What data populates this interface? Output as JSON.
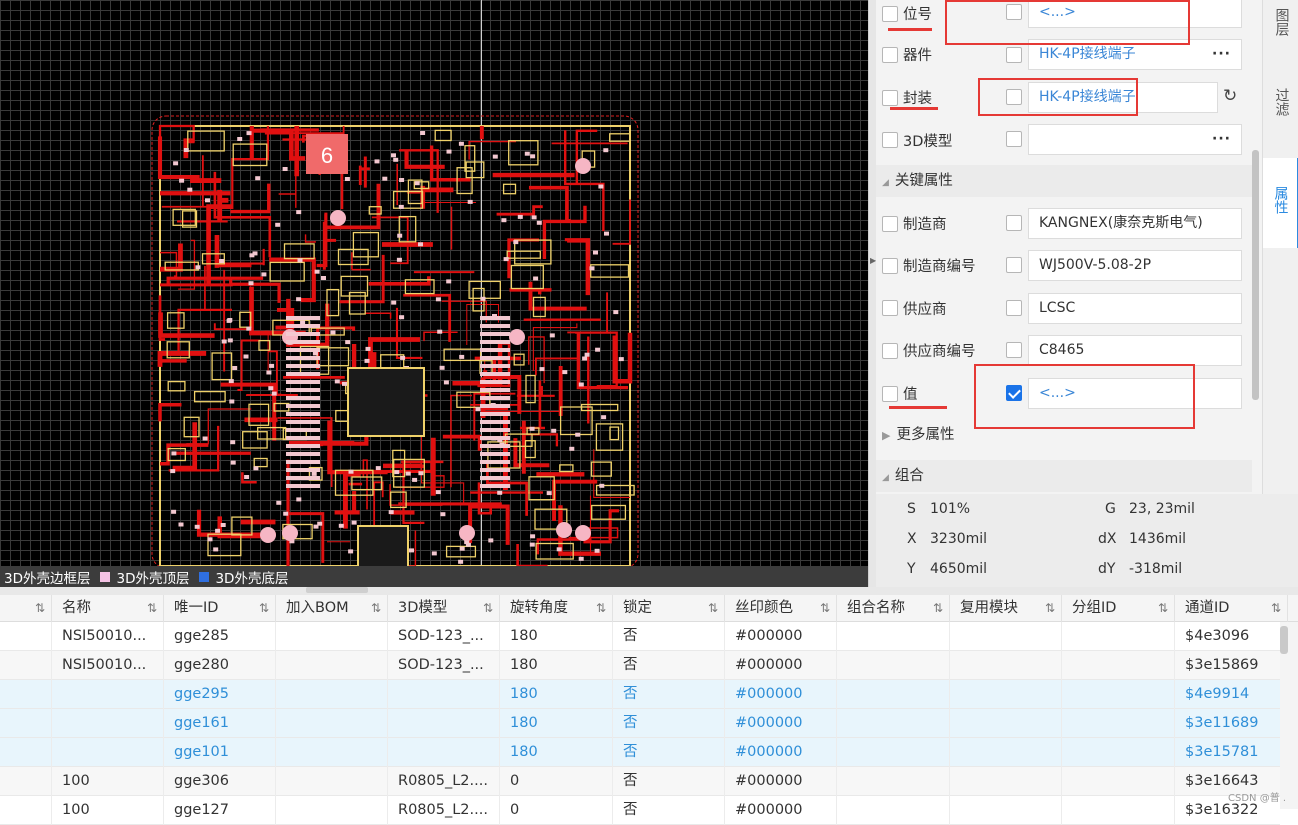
{
  "board": {
    "designator": "6"
  },
  "layer_tabs": [
    {
      "label": "3D外壳边框层",
      "color": ""
    },
    {
      "label": "3D外壳顶层",
      "color": "#f4c2e4"
    },
    {
      "label": "3D外壳底层",
      "color": "#2f6fe0"
    }
  ],
  "properties": {
    "rows": [
      {
        "label": "位号",
        "value": "<...>",
        "link": true
      },
      {
        "label": "器件",
        "value": "HK-4P接线端子",
        "link": true,
        "more": "···"
      },
      {
        "label": "封装",
        "value": "HK-4P接线端子",
        "link": true,
        "refresh": "↻"
      },
      {
        "label": "3D模型",
        "value": "",
        "link": false,
        "more": "···"
      }
    ],
    "key_section": "关键属性",
    "key_rows": [
      {
        "label": "制造商",
        "value": "KANGNEX(康奈克斯电气)"
      },
      {
        "label": "制造商编号",
        "value": "WJ500V-5.08-2P"
      },
      {
        "label": "供应商",
        "value": "LCSC"
      },
      {
        "label": "供应商编号",
        "value": "C8465"
      },
      {
        "label": "值",
        "value": "<...>"
      }
    ],
    "more_section": "更多属性",
    "group_section": "组合"
  },
  "side_tabs": [
    "图层",
    "过滤",
    "属性"
  ],
  "info": {
    "s_label": "S",
    "s_value": "101%",
    "g_label": "G",
    "g_value": "23, 23mil",
    "x_label": "X",
    "x_value": "3230mil",
    "dx_label": "dX",
    "dx_value": "1436mil",
    "y_label": "Y",
    "y_value": "4650mil",
    "dy_label": "dY",
    "dy_value": "-318mil"
  },
  "table": {
    "columns": [
      "",
      "名称",
      "唯一ID",
      "加入BOM",
      "3D模型",
      "旋转角度",
      "锁定",
      "丝印颜色",
      "组合名称",
      "复用模块",
      "分组ID",
      "通道ID"
    ],
    "rows": [
      {
        "cells": [
          "",
          "NSI50010...",
          "gge285",
          "",
          "SOD-123_...",
          "180",
          "否",
          "#000000",
          "",
          "",
          "",
          "$4e3096"
        ],
        "state": ""
      },
      {
        "cells": [
          "",
          "NSI50010...",
          "gge280",
          "",
          "SOD-123_...",
          "180",
          "否",
          "#000000",
          "",
          "",
          "",
          "$3e15869"
        ],
        "state": "alt"
      },
      {
        "cells": [
          "",
          "",
          "gge295",
          "",
          "",
          "180",
          "否",
          "#000000",
          "",
          "",
          "",
          "$4e9914"
        ],
        "state": "sel"
      },
      {
        "cells": [
          "",
          "",
          "gge161",
          "",
          "",
          "180",
          "否",
          "#000000",
          "",
          "",
          "",
          "$3e11689"
        ],
        "state": "sel"
      },
      {
        "cells": [
          "",
          "",
          "gge101",
          "",
          "",
          "180",
          "否",
          "#000000",
          "",
          "",
          "",
          "$3e15781"
        ],
        "state": "sel"
      },
      {
        "cells": [
          "",
          "100",
          "gge306",
          "",
          "R0805_L2....",
          "0",
          "否",
          "#000000",
          "",
          "",
          "",
          "$3e16643"
        ],
        "state": "alt"
      },
      {
        "cells": [
          "",
          "100",
          "gge127",
          "",
          "R0805_L2....",
          "0",
          "否",
          "#000000",
          "",
          "",
          "",
          "$3e16322"
        ],
        "state": ""
      }
    ]
  },
  "watermark": "CSDN @普 ."
}
